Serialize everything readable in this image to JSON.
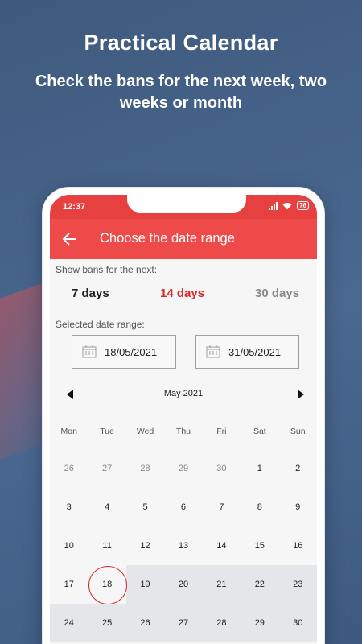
{
  "promo": {
    "title": "Practical Calendar",
    "subtitle": "Check the bans for the next week, two weeks or month"
  },
  "status_bar": {
    "time": "12:37",
    "battery": "76"
  },
  "app_bar": {
    "title": "Choose the date range",
    "back_icon": "arrow-left-icon"
  },
  "range_selector": {
    "label": "Show bans for the next:",
    "options": [
      {
        "label": "7 days",
        "color": "#222222"
      },
      {
        "label": "14 days",
        "color": "#d92626"
      },
      {
        "label": "30 days",
        "color": "#8a8a8a"
      }
    ],
    "selected": "14 days"
  },
  "date_range": {
    "label": "Selected date range:",
    "start": "18/05/2021",
    "end": "31/05/2021",
    "icon": "calendar-icon"
  },
  "calendar": {
    "month": "May 2021",
    "weekdays": [
      "Mon",
      "Tue",
      "Wed",
      "Thu",
      "Fri",
      "Sat",
      "Sun"
    ],
    "weeks": [
      [
        "26",
        "27",
        "28",
        "29",
        "30",
        "1",
        "2"
      ],
      [
        "3",
        "4",
        "5",
        "6",
        "7",
        "8",
        "9"
      ],
      [
        "10",
        "11",
        "12",
        "13",
        "14",
        "15",
        "16"
      ],
      [
        "17",
        "18",
        "19",
        "20",
        "21",
        "22",
        "23"
      ],
      [
        "24",
        "25",
        "26",
        "27",
        "28",
        "29",
        "30"
      ]
    ],
    "selected_day": "18",
    "accent_color": "#ef4a4a",
    "highlight_color": "#e4e6ea"
  }
}
